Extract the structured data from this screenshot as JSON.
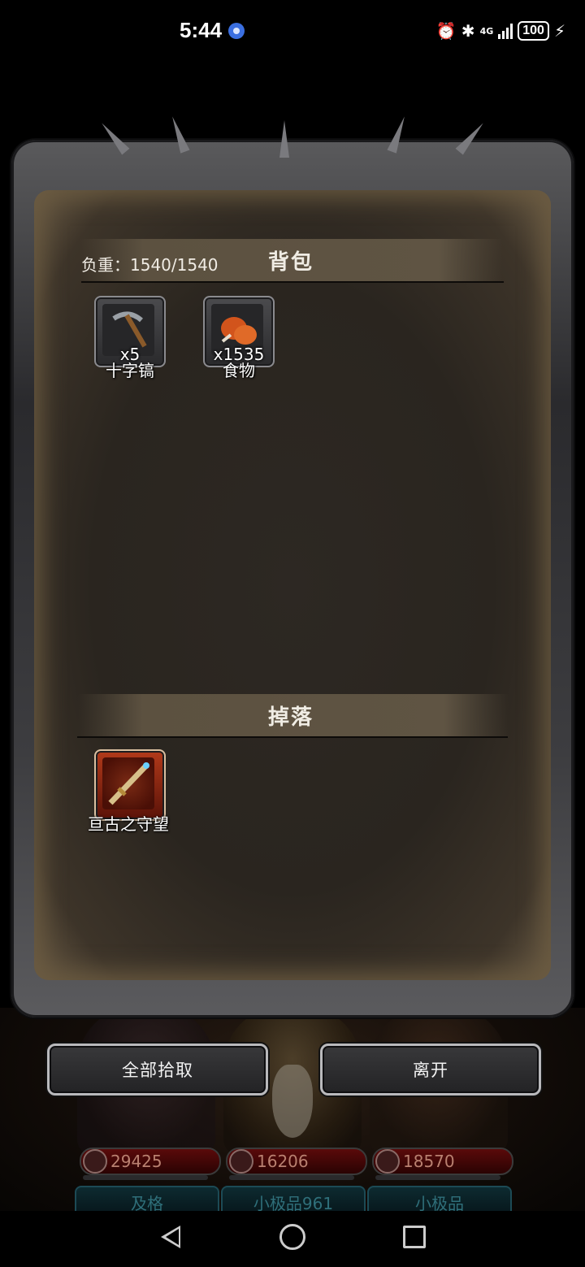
{
  "status_bar": {
    "time": "5:44",
    "network": "4G",
    "battery": "100"
  },
  "backpack": {
    "weight_label": "负重：1540/1540",
    "title": "背包",
    "items": [
      {
        "name": "十字镐",
        "count": "x5",
        "icon": "pickaxe-icon"
      },
      {
        "name": "食物",
        "count": "x1535",
        "icon": "food-icon"
      }
    ]
  },
  "drops": {
    "title": "掉落",
    "items": [
      {
        "name": "亘古之守望",
        "icon": "sword-icon",
        "rarity_color": "#b23a1a"
      }
    ]
  },
  "actions": {
    "pickup_all": "全部拾取",
    "leave": "离开"
  },
  "party": [
    {
      "power": "29425",
      "grade": "及格"
    },
    {
      "power": "16206",
      "grade": "小极品961"
    },
    {
      "power": "18570",
      "grade": "小极品"
    }
  ],
  "colors": {
    "parchment": "#2d2823",
    "frame": "#3d3d40",
    "header_bar": "#5c5140",
    "power_bar": "#5a0a0a",
    "grade_text": "#2f6f7a"
  }
}
